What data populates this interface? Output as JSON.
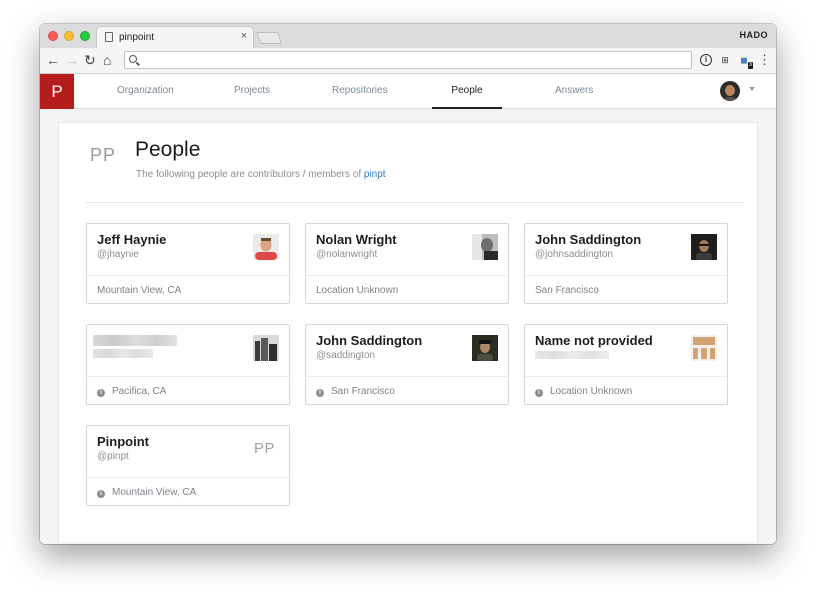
{
  "browser": {
    "tab_title": "pinpoint",
    "tab_close": "×",
    "profile_name": "HADO",
    "address": "",
    "back_glyph": "←",
    "forward_glyph": "→",
    "reload_glyph": "↻",
    "home_glyph": "⌂",
    "menu_glyph": "⋮",
    "extensions": [
      {
        "name": "info-icon",
        "glyph": "i"
      },
      {
        "name": "translate-icon",
        "glyph": "⊞"
      },
      {
        "name": "extension-icon",
        "glyph": "◼",
        "badge": "3"
      }
    ]
  },
  "app": {
    "logo_letter": "P",
    "logo_color": "#b71c1c",
    "nav": [
      {
        "label": "Organization",
        "active": false
      },
      {
        "label": "Projects",
        "active": false
      },
      {
        "label": "Repositories",
        "active": false
      },
      {
        "label": "People",
        "active": true
      },
      {
        "label": "Answers",
        "active": false
      }
    ]
  },
  "page": {
    "org_initials": "PP",
    "title": "People",
    "subtitle_text": "The following people are contributors / members of ",
    "subtitle_link": "pinpt"
  },
  "people": [
    {
      "name": "Jeff Haynie",
      "handle": "@jhaynie",
      "location": "Mountain View, CA",
      "avatar": "photo-red-shirt",
      "show_info_icon": false
    },
    {
      "name": "Nolan Wright",
      "handle": "@nolanwright",
      "location": "Location Unknown",
      "avatar": "photo-bw",
      "show_info_icon": false
    },
    {
      "name": "John Saddington",
      "handle": "@johnsaddington",
      "location": "San Francisco",
      "avatar": "photo-dark",
      "show_info_icon": false
    },
    {
      "name": "",
      "handle": "",
      "location": "Pacifica, CA",
      "avatar": "photo-buildings",
      "show_info_icon": true,
      "blurred": true
    },
    {
      "name": "John Saddington",
      "handle": "@saddington",
      "location": "San Francisco",
      "avatar": "photo-dark",
      "show_info_icon": true
    },
    {
      "name": "Name not provided",
      "handle": "",
      "location": "Location Unknown",
      "avatar": "identicon-orange",
      "show_info_icon": true,
      "blurred_handle": true
    },
    {
      "name": "Pinpoint",
      "handle": "@pinpt",
      "location": "Mountain View, CA",
      "avatar_initials": "PP",
      "show_info_icon": true
    }
  ],
  "colors": {
    "accent": "#b71c1c",
    "link": "#2e7bc4",
    "identicon": "#d4a373"
  }
}
